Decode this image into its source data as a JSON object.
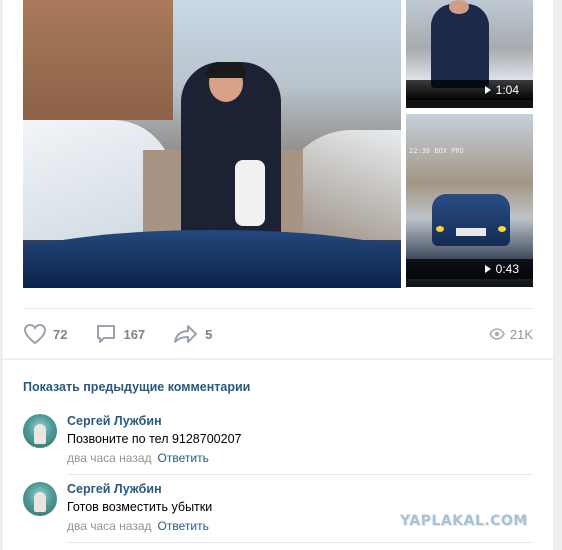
{
  "post": {
    "videos": [
      {
        "duration": "1:04"
      },
      {
        "duration": "0:43"
      }
    ],
    "thumb_timestamp": "22:38 BOX PRO",
    "actions": {
      "likes": "72",
      "comments": "167",
      "shares": "5",
      "views": "21K"
    },
    "icons": {
      "like": "heart-icon",
      "comment": "comment-bubble-icon",
      "share": "share-arrow-icon",
      "views": "eye-icon",
      "play": "play-icon"
    }
  },
  "comments": {
    "show_previous": "Показать предыдущие комментарии",
    "items": [
      {
        "author": "Сергей Лужбин",
        "text": "Позвоните по тел 9128700207",
        "time": "два часа назад",
        "reply": "Ответить"
      },
      {
        "author": "Сергей Лужбин",
        "text": "Готов возместить убытки",
        "time": "два часа назад",
        "reply": "Ответить"
      }
    ]
  },
  "watermark": "YAPLAKAL.COM",
  "colors": {
    "link": "#2a5885",
    "muted": "#828282",
    "background": "#edeef0"
  }
}
